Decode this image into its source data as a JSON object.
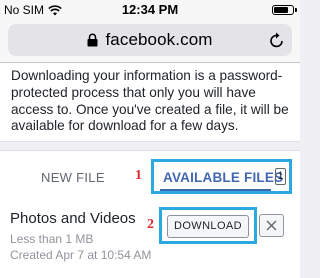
{
  "status_bar": {
    "carrier": "No SIM",
    "time": "12:34 PM"
  },
  "address_bar": {
    "url": "facebook.com"
  },
  "info": {
    "text": "Downloading your information is a password-protected process that only you will have access to. Once you've created a file, it will be available for download for a few days."
  },
  "tabs": {
    "new_file": "NEW FILE",
    "available_files": "AVAILABLE FILES",
    "available_count": "1"
  },
  "annotations": {
    "step1": "1",
    "step2": "2"
  },
  "file": {
    "title": "Photos and Videos",
    "size": "Less than 1 MB",
    "created": "Created Apr 7 at 10:54 AM",
    "download_label": "DOWNLOAD"
  },
  "icons": {
    "wifi": "wifi-icon",
    "battery": "battery-icon",
    "lock": "lock-icon",
    "reload": "reload-icon",
    "close": "close-icon"
  },
  "colors": {
    "highlight": "#2ba8e0",
    "annotation": "#e0282e",
    "active_tab": "#4267b2"
  }
}
